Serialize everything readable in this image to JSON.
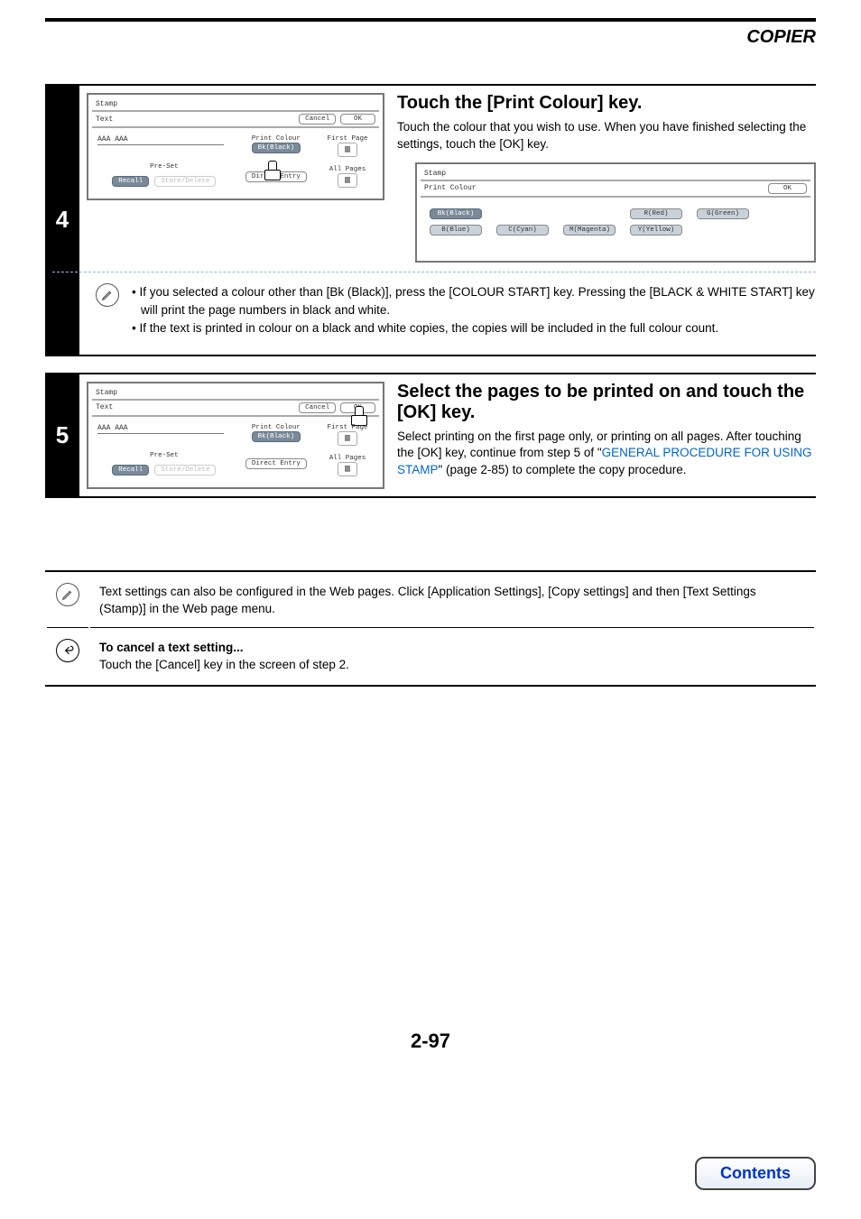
{
  "header": {
    "title": "COPIER"
  },
  "step4": {
    "number": "4",
    "heading": "Touch the [Print Colour] key.",
    "text": "Touch the colour that you wish to use. When you have finished selecting the settings, touch the [OK] key.",
    "panel1": {
      "title": "Stamp",
      "subtitle": "Text",
      "cancel": "Cancel",
      "ok": "OK",
      "sample": "AAA AAA",
      "preset": "Pre-Set",
      "recall": "Recall",
      "store": "Store/Delete",
      "printcolour_label": "Print Colour",
      "printcolour_value": "Bk(Black)",
      "direct": "Direct Entry",
      "first": "First Page",
      "all": "All Pages"
    },
    "panel2": {
      "title": "Stamp",
      "subtitle": "Print Colour",
      "ok": "OK",
      "colours": {
        "bk": "Bk(Black)",
        "r": "R(Red)",
        "g": "G(Green)",
        "b": "B(Blue)",
        "c": "C(Cyan)",
        "m": "M(Magenta)",
        "y": "Y(Yellow)"
      }
    },
    "notes": {
      "n1": "If you selected a colour other than [Bk (Black)], press the [COLOUR START] key. Pressing the [BLACK & WHITE START] key will print the page numbers in black and white.",
      "n2": "If the text is printed in colour on a black and white copies, the copies will be included in the full colour count."
    }
  },
  "step5": {
    "number": "5",
    "heading": "Select the pages to be printed on and touch the [OK] key.",
    "text_pre": "Select printing on the first page only, or printing on all pages. After touching the [OK] key, continue from step 5 of \"",
    "link": "GENERAL PROCEDURE FOR USING STAMP",
    "text_post": "\" (page 2-85) to complete the copy procedure.",
    "panel": {
      "title": "Stamp",
      "subtitle": "Text",
      "cancel": "Cancel",
      "ok": "OK",
      "sample": "AAA AAA",
      "preset": "Pre-Set",
      "recall": "Recall",
      "store": "Store/Delete",
      "printcolour_label": "Print Colour",
      "printcolour_value": "Bk(Black)",
      "direct": "Direct Entry",
      "first": "First Page",
      "all": "All Pages"
    }
  },
  "info": {
    "note": "Text settings can also be configured in the Web pages. Click [Application Settings], [Copy settings] and then [Text Settings (Stamp)] in the Web page menu.",
    "cancel_title": "To cancel a text setting...",
    "cancel_body": "Touch the [Cancel] key in the screen of step 2."
  },
  "footer": {
    "pagenum": "2-97",
    "contents": "Contents"
  }
}
